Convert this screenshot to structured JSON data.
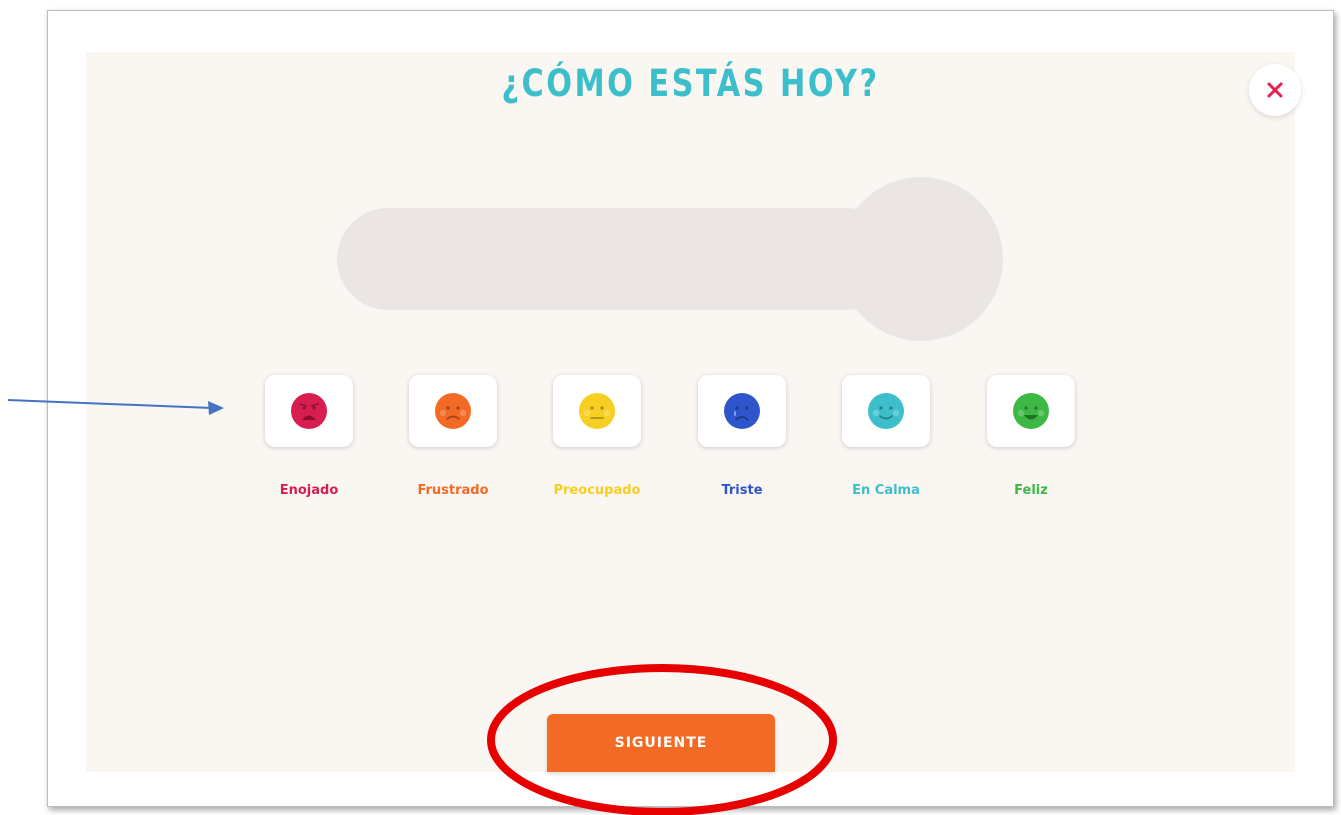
{
  "dialog": {
    "title": "¿CÓMO ESTÁS HOY?",
    "close_icon": "close-icon"
  },
  "moods": [
    {
      "label": "Enojado",
      "color": "#d81e4f",
      "face": "angry"
    },
    {
      "label": "Frustrado",
      "color": "#f26a24",
      "face": "frustrated"
    },
    {
      "label": "Preocupado",
      "color": "#f7cf22",
      "face": "worried"
    },
    {
      "label": "Triste",
      "color": "#2f55cc",
      "face": "sad"
    },
    {
      "label": "En Calma",
      "color": "#3dbfcb",
      "face": "calm"
    },
    {
      "label": "Feliz",
      "color": "#3db845",
      "face": "happy"
    }
  ],
  "footer": {
    "next_label": "SIGUIENTE"
  },
  "colors": {
    "accent": "#3dbfcb",
    "button": "#f26a24",
    "close": "#e5204f",
    "annotation_arrow": "#4472c4",
    "annotation_circle": "#e60000"
  }
}
